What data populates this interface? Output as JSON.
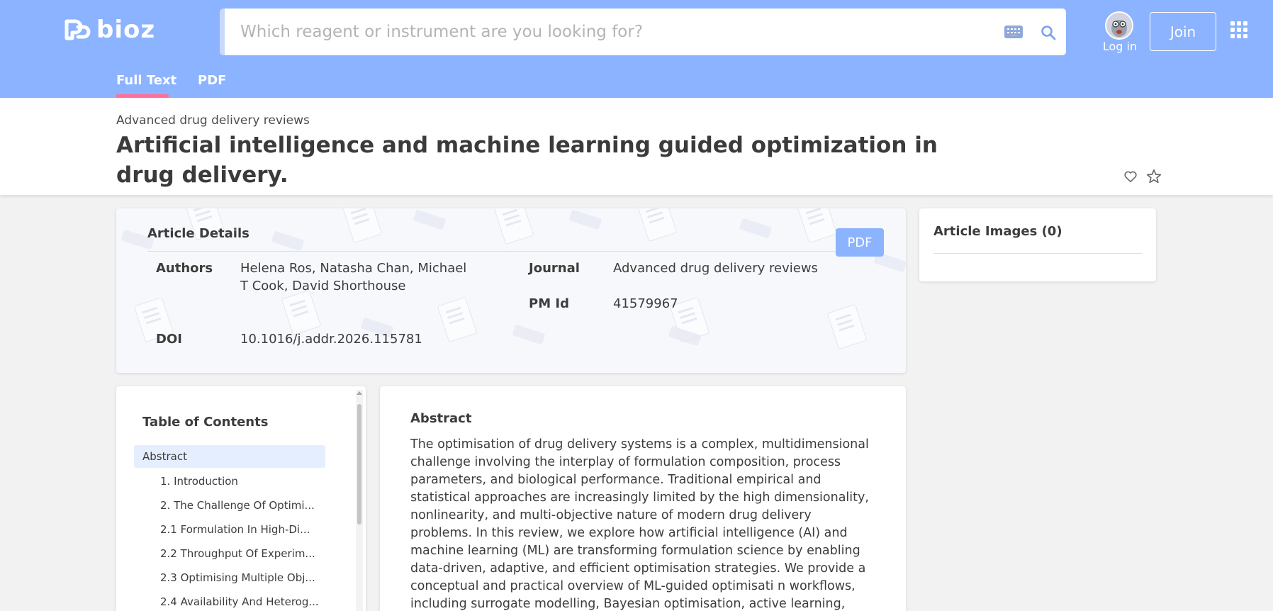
{
  "header": {
    "logo_text": "bioz",
    "search_placeholder": "Which reagent or instrument are you looking for?",
    "login_label": "Log in",
    "join_label": "Join",
    "tabs": [
      {
        "label": "Full Text",
        "active": true
      },
      {
        "label": "PDF",
        "active": false
      }
    ],
    "accent_color": "#8cb3ff",
    "tab_indicator_color": "#ff6f9c",
    "icons": [
      "keyboard-icon",
      "search-icon",
      "user-avatar",
      "apps-grid-icon"
    ]
  },
  "article": {
    "journal": "Advanced drug delivery reviews",
    "title": "Artificial intelligence and machine learning guided optimization in drug delivery.",
    "icons": [
      "heart-icon",
      "star-icon"
    ]
  },
  "details": {
    "title": "Article Details",
    "pdf_button": "PDF",
    "authors_label": "Authors",
    "authors_value": "Helena Ros, Natasha Chan, Michael T Cook, David Shorthouse",
    "journal_label": "Journal",
    "journal_value": "Advanced drug delivery reviews",
    "pmid_label": "PM Id",
    "pmid_value": "41579967",
    "doi_label": "DOI",
    "doi_value": "10.1016/j.addr.2026.115781"
  },
  "images_panel": {
    "title": "Article Images (0)"
  },
  "toc": {
    "title": "Table of Contents",
    "items": [
      {
        "label": "Abstract",
        "active": true
      },
      {
        "label": "1. Introduction"
      },
      {
        "label": "2. The Challenge Of Optimi..."
      },
      {
        "label": "2.1 Formulation In High-Di..."
      },
      {
        "label": "2.2 Throughput Of Experim..."
      },
      {
        "label": "2.3 Optimising Multiple Obj..."
      },
      {
        "label": "2.4 Availability And Heterog..."
      }
    ]
  },
  "abstract": {
    "heading": "Abstract",
    "lines": [
      "The optimisation of drug delivery systems is a complex, multidimensional",
      "challenge involving the interplay of formulation composition, process",
      "parameters, and biological performance. Traditional empirical and",
      "statistical approaches are increasingly limited by the high dimensionality,",
      "nonlinearity, and multi-objective nature of modern drug delivery",
      "problems. In this review, we explore how artificial intelligence (AI) and",
      "machine learning (ML) are transforming formulation science by enabling",
      "data-driven, adaptive, and efficient optimisation strategies. We provide a",
      "conceptual and practical overview of ML-guided optimisati n workflows,",
      "including surrogate modelling, Bayesian optimisation, active learning,"
    ]
  }
}
